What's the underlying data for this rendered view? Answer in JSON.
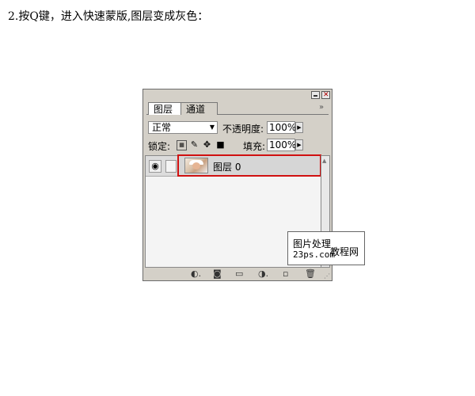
{
  "instruction": "2.按Q键，进入快速蒙版,图层变成灰色：",
  "panel": {
    "tabs": [
      {
        "label": "图层",
        "active": true
      },
      {
        "label": "通道",
        "active": false
      }
    ],
    "more_icon": "»",
    "blend_mode": "正常",
    "opacity_label": "不透明度:",
    "opacity_value": "100%",
    "lock_label": "锁定:",
    "lock_icons": [
      "lock-transparent-icon",
      "lock-paint-icon",
      "lock-move-icon",
      "lock-all-icon"
    ],
    "fill_label": "填充:",
    "fill_value": "100%",
    "layers": [
      {
        "name": "图层 0",
        "visible": true,
        "highlighted_color": "#d01010"
      }
    ],
    "footer_icons": [
      "layer-style-icon",
      "add-mask-icon",
      "new-group-icon",
      "adjustment-layer-icon",
      "new-layer-icon",
      "delete-layer-icon"
    ]
  },
  "watermark": {
    "line1": "图片处理",
    "line2": "23ps.com",
    "side": "教程网"
  }
}
